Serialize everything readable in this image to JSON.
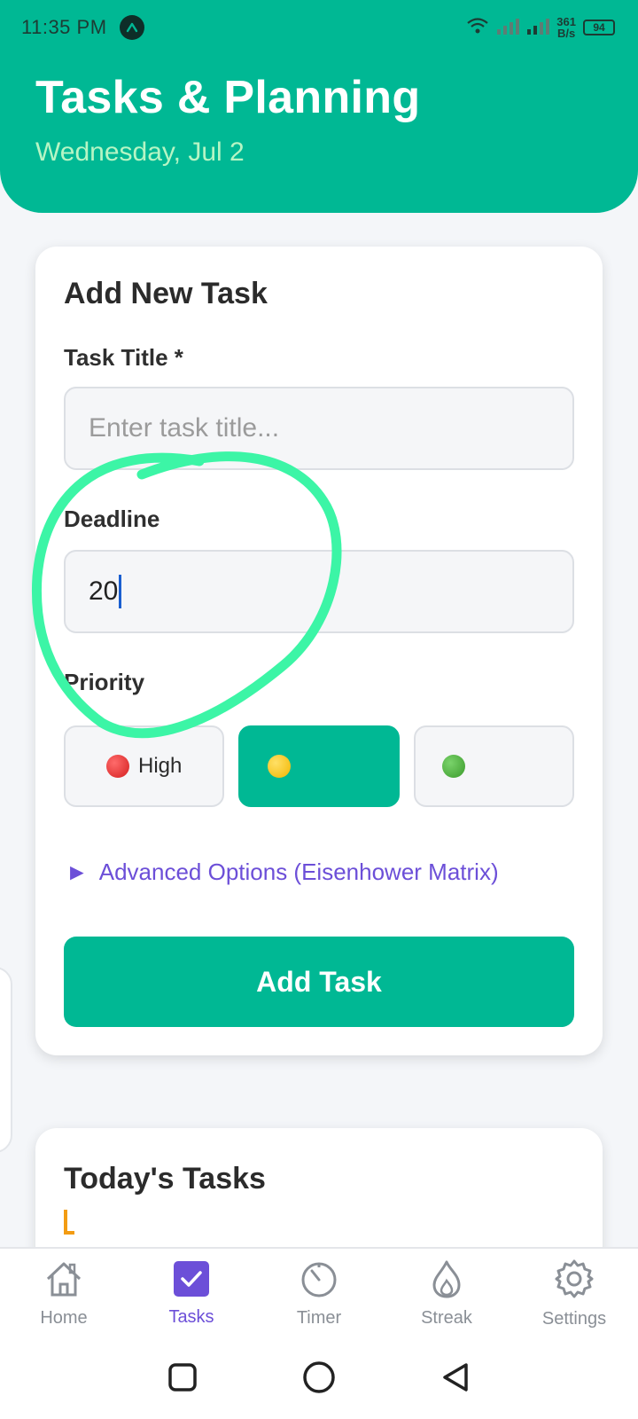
{
  "status_bar": {
    "time": "11:35 PM",
    "net_speed_value": "361",
    "net_speed_unit": "B/s",
    "battery": "94"
  },
  "header": {
    "title": "Tasks & Planning",
    "date": "Wednesday, Jul 2"
  },
  "add_task": {
    "heading": "Add New Task",
    "title_label": "Task Title *",
    "title_placeholder": "Enter task title...",
    "deadline_label": "Deadline",
    "deadline_value": "20",
    "priority_label": "Priority",
    "priorities": [
      {
        "label": "High",
        "color": "#d41f1f",
        "selected": false
      },
      {
        "label": "",
        "color": "#f2b600",
        "selected": true
      },
      {
        "label": "",
        "color": "#3a9a2b",
        "selected": false
      }
    ],
    "advanced_arrow": "►",
    "advanced_label": "Advanced Options (Eisenhower Matrix)",
    "submit_label": "Add Task"
  },
  "today": {
    "heading": "Today's Tasks"
  },
  "bottom_nav": {
    "items": [
      {
        "label": "Home",
        "icon": "home-icon",
        "active": false
      },
      {
        "label": "Tasks",
        "icon": "checkbox-icon",
        "active": true
      },
      {
        "label": "Timer",
        "icon": "timer-icon",
        "active": false
      },
      {
        "label": "Streak",
        "icon": "flame-icon",
        "active": false
      },
      {
        "label": "Settings",
        "icon": "gear-icon",
        "active": false
      }
    ]
  },
  "colors": {
    "brand": "#00b894",
    "accent": "#6c4fd8",
    "date_text": "#b6f5c4",
    "annotation_circle": "#3cf5a6"
  }
}
